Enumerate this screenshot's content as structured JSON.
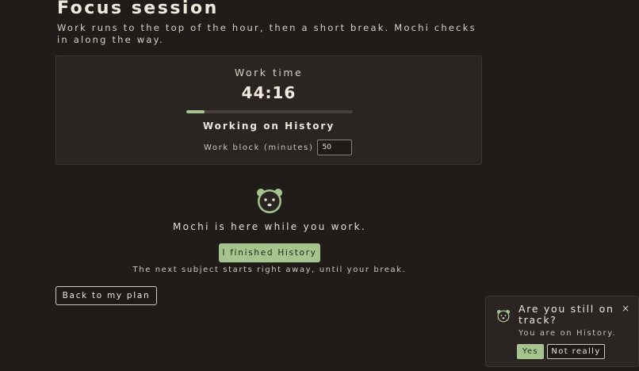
{
  "page": {
    "title": "Focus session",
    "subtitle": "Work runs to the top of the hour, then a short break. Mochi checks in along the way."
  },
  "timer": {
    "label": "Work time",
    "value": "44:16",
    "progress_fraction": 0.11,
    "working_on": "Working on History",
    "work_block_label": "Work block (minutes)",
    "work_block_value": "50"
  },
  "mochi": {
    "icon": "mochi-bear-face-icon",
    "message": "Mochi is here while you work."
  },
  "actions": {
    "finish_label": "I finished History",
    "next_note": "The next subject starts right away, until your break.",
    "back_label": "Back to my plan"
  },
  "checkin": {
    "icon": "mochi-bear-face-icon",
    "question": "Are you still on track?",
    "detail": "You are on History.",
    "yes_label": "Yes",
    "no_label": "Not really",
    "close_glyph": "×"
  },
  "colors": {
    "background": "#201c1a",
    "card": "#2a2522",
    "accent_green": "#a6c48d",
    "text": "#e8e2d6"
  }
}
